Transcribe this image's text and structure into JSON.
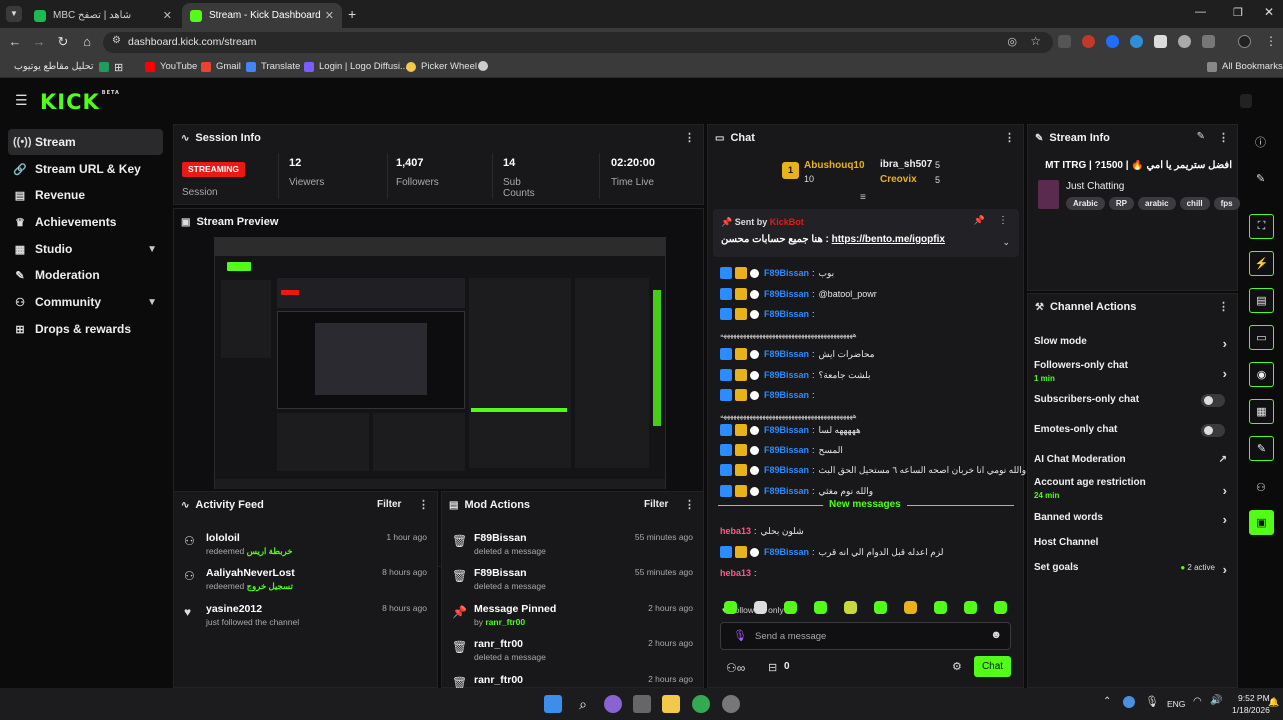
{
  "browser": {
    "tabs": [
      {
        "title": "MBC شاهد | تصفح",
        "active": false
      },
      {
        "title": "Stream - Kick Dashboard",
        "active": true
      }
    ],
    "url": "dashboard.kick.com/stream",
    "bookmarks": [
      "تحليل مقاطع يوتيوب",
      "YouTube",
      "Gmail",
      "Translate",
      "Login | Logo Diffusi...",
      "Picker Wheel"
    ],
    "all_bookmarks": "All Bookmarks"
  },
  "app": {
    "logo": "KICK",
    "logo_beta": "BETA",
    "sidebar": [
      {
        "label": "Stream",
        "icon": "stream-icon"
      },
      {
        "label": "Stream URL & Key",
        "icon": "link-icon"
      },
      {
        "label": "Revenue",
        "icon": "bank-icon"
      },
      {
        "label": "Achievements",
        "icon": "trophy-icon"
      },
      {
        "label": "Studio",
        "icon": "studio-icon"
      },
      {
        "label": "Moderation",
        "icon": "wrench-icon"
      },
      {
        "label": "Community",
        "icon": "community-icon"
      },
      {
        "label": "Drops & rewards",
        "icon": "gift-icon"
      }
    ],
    "session": {
      "title": "Session Info",
      "status": "STREAMING",
      "status_label": "Session",
      "stats": [
        {
          "value": "12",
          "label": "Viewers"
        },
        {
          "value": "1,407",
          "label": "Followers"
        },
        {
          "value": "14",
          "label": "Sub Counts"
        },
        {
          "value": "02:20:00",
          "label": "Time Live"
        }
      ]
    },
    "preview": {
      "title": "Stream Preview"
    },
    "activity": {
      "title": "Activity Feed",
      "filter": "Filter",
      "items": [
        {
          "name": "lololoil",
          "prefix": "redeemed",
          "reward": "خربطة اريس",
          "time": "1 hour ago"
        },
        {
          "name": "AaliyahNeverLost",
          "prefix": "redeemed",
          "reward": "تسجيل خروج",
          "time": "8 hours ago"
        },
        {
          "name": "yasine2012",
          "prefix": "just followed the channel",
          "reward": "",
          "time": "8 hours ago"
        }
      ]
    },
    "mod": {
      "title": "Mod Actions",
      "filter": "Filter",
      "items": [
        {
          "name": "F89Bissan",
          "sub": "deleted a message",
          "by": "",
          "time": "55 minutes ago"
        },
        {
          "name": "F89Bissan",
          "sub": "deleted a message",
          "by": "",
          "time": "55 minutes ago"
        },
        {
          "name": "Message Pinned",
          "sub": "by",
          "by": "ranr_ftr00",
          "time": "2 hours ago"
        },
        {
          "name": "ranr_ftr00",
          "sub": "deleted a message",
          "by": "",
          "time": "2 hours ago"
        },
        {
          "name": "ranr_ftr00",
          "sub": "",
          "by": "",
          "time": "2 hours ago"
        }
      ]
    },
    "chat": {
      "title": "Chat",
      "top": [
        {
          "rank": "1",
          "name": "Abushouq10",
          "count": "10"
        },
        {
          "name": "ibra_sh507",
          "count": "5"
        },
        {
          "name": "Creovix",
          "count": "5"
        }
      ],
      "pinned": {
        "label": "Sent by",
        "sender": "KickBot",
        "text": "هنا جميع حسابات محسن :",
        "link": "https://bento.me/igopfix"
      },
      "messages": [
        {
          "user": "F89Bissan",
          "text": "بوب"
        },
        {
          "user": "F89Bissan",
          "text": "@batool_powr"
        },
        {
          "user": "F89Bissan",
          "text": ""
        },
        {
          "user": "",
          "text": "هههههههههههههههههههههههههههههههههههههههههه"
        },
        {
          "user": "F89Bissan",
          "text": "محاضرات ايش"
        },
        {
          "user": "F89Bissan",
          "text": "بلشت جامعة؟"
        },
        {
          "user": "F89Bissan",
          "text": ""
        },
        {
          "user": "",
          "text": "هههههههههههههههههههههههههههههههههههههههههه"
        },
        {
          "user": "F89Bissan",
          "text": "هههههه لسا"
        },
        {
          "user": "F89Bissan",
          "text": "المسح"
        },
        {
          "user": "F89Bissan",
          "text": "والله نومي انا خربان اصحه الساعه ٦ مستحيل الحق البث"
        },
        {
          "user": "F89Bissan",
          "text": "والله نوم مغثي"
        }
      ],
      "new_messages": "New messages",
      "after": [
        {
          "user": "heba13",
          "text": "شلون بحلي"
        },
        {
          "user": "F89Bissan",
          "text": "لزم اعدله قبل الدوام الي انه قرب"
        },
        {
          "user": "heba13",
          "text": ""
        }
      ],
      "followers_only": "Followers only",
      "placeholder": "Send a message",
      "count": "0",
      "send": "Chat"
    },
    "stream_info": {
      "title": "Stream Info",
      "stream_title": "افضل ستريمر يا امي 🔥 | 1500? | MT ITRG",
      "category": "Just Chatting",
      "tags": [
        "Arabic",
        "RP",
        "arabic",
        "chill",
        "fps"
      ]
    },
    "channel_actions": {
      "title": "Channel Actions",
      "items": [
        {
          "label": "Slow mode",
          "sub": "",
          "kind": "arrow"
        },
        {
          "label": "Followers-only chat",
          "sub": "1 min",
          "kind": "arrow"
        },
        {
          "label": "Subscribers-only chat",
          "sub": "",
          "kind": "toggle"
        },
        {
          "label": "Emotes-only chat",
          "sub": "",
          "kind": "toggle"
        },
        {
          "label": "AI Chat Moderation",
          "sub": "",
          "kind": "link"
        },
        {
          "label": "Account age restriction",
          "sub": "24 min",
          "kind": "arrow"
        },
        {
          "label": "Banned words",
          "sub": "",
          "kind": "arrow"
        },
        {
          "label": "Host Channel",
          "sub": "",
          "kind": "none"
        },
        {
          "label": "Set goals",
          "sub": "",
          "kind": "goal",
          "status": "2 active"
        }
      ]
    }
  },
  "taskbar": {
    "lang": "ENG",
    "time": "9:52 PM",
    "date": "1/18/2026"
  },
  "colors": {
    "accent": "#53fc18",
    "user": "#2a8cff",
    "streaming": "#e91916"
  }
}
